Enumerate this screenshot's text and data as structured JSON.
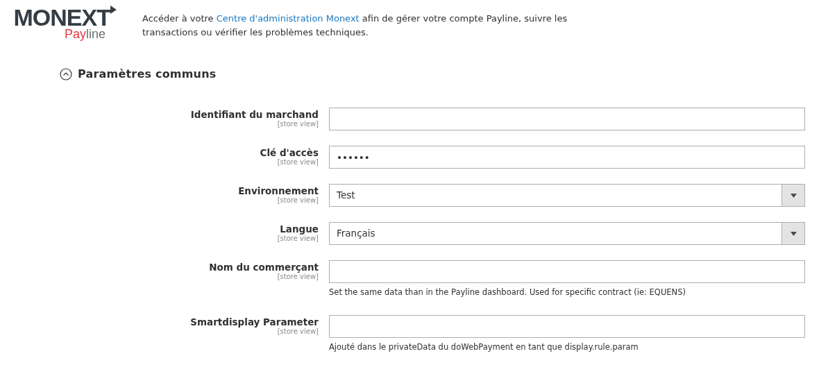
{
  "logo": {
    "brand": "MONEXT",
    "product_red": "Pay",
    "product_grey": "line"
  },
  "intro": {
    "before": "Accéder à votre ",
    "link": "Centre d'administration Monext",
    "after": " afin de gérer votre compte Payline, suivre les transactions ou vérifier les problèmes techniques."
  },
  "section": {
    "title": "Paramètres communs",
    "expanded": true
  },
  "fields": [
    {
      "label": "Identifiant du marchand",
      "scope": "[store view]",
      "kind": "text"
    },
    {
      "label": "Clé d'accès",
      "scope": "[store view]",
      "kind": "text",
      "value": "••••••"
    },
    {
      "label": "Environnement",
      "scope": "[store view]",
      "kind": "select",
      "value": "Test"
    },
    {
      "label": "Langue",
      "scope": "[store view]",
      "kind": "select",
      "value": "Français"
    },
    {
      "label": "Nom du commerçant",
      "scope": "[store view]",
      "kind": "text",
      "note": "Set the same data than in the Payline dashboard. Used for specific contract (ie: EQUENS)"
    },
    {
      "label": "Smartdisplay Parameter",
      "scope": "[store view]",
      "kind": "text",
      "note": "Ajouté dans le privateData du doWebPayment en tant que display.rule.param"
    }
  ]
}
